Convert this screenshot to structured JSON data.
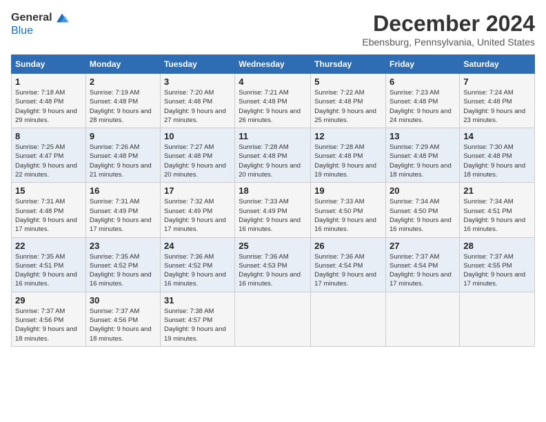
{
  "header": {
    "logo_general": "General",
    "logo_blue": "Blue",
    "month_title": "December 2024",
    "location": "Ebensburg, Pennsylvania, United States"
  },
  "days_of_week": [
    "Sunday",
    "Monday",
    "Tuesday",
    "Wednesday",
    "Thursday",
    "Friday",
    "Saturday"
  ],
  "weeks": [
    [
      {
        "day": "1",
        "sunrise": "7:18 AM",
        "sunset": "4:48 PM",
        "daylight": "9 hours and 29 minutes."
      },
      {
        "day": "2",
        "sunrise": "7:19 AM",
        "sunset": "4:48 PM",
        "daylight": "9 hours and 28 minutes."
      },
      {
        "day": "3",
        "sunrise": "7:20 AM",
        "sunset": "4:48 PM",
        "daylight": "9 hours and 27 minutes."
      },
      {
        "day": "4",
        "sunrise": "7:21 AM",
        "sunset": "4:48 PM",
        "daylight": "9 hours and 26 minutes."
      },
      {
        "day": "5",
        "sunrise": "7:22 AM",
        "sunset": "4:48 PM",
        "daylight": "9 hours and 25 minutes."
      },
      {
        "day": "6",
        "sunrise": "7:23 AM",
        "sunset": "4:48 PM",
        "daylight": "9 hours and 24 minutes."
      },
      {
        "day": "7",
        "sunrise": "7:24 AM",
        "sunset": "4:48 PM",
        "daylight": "9 hours and 23 minutes."
      }
    ],
    [
      {
        "day": "8",
        "sunrise": "7:25 AM",
        "sunset": "4:47 PM",
        "daylight": "9 hours and 22 minutes."
      },
      {
        "day": "9",
        "sunrise": "7:26 AM",
        "sunset": "4:48 PM",
        "daylight": "9 hours and 21 minutes."
      },
      {
        "day": "10",
        "sunrise": "7:27 AM",
        "sunset": "4:48 PM",
        "daylight": "9 hours and 20 minutes."
      },
      {
        "day": "11",
        "sunrise": "7:28 AM",
        "sunset": "4:48 PM",
        "daylight": "9 hours and 20 minutes."
      },
      {
        "day": "12",
        "sunrise": "7:28 AM",
        "sunset": "4:48 PM",
        "daylight": "9 hours and 19 minutes."
      },
      {
        "day": "13",
        "sunrise": "7:29 AM",
        "sunset": "4:48 PM",
        "daylight": "9 hours and 18 minutes."
      },
      {
        "day": "14",
        "sunrise": "7:30 AM",
        "sunset": "4:48 PM",
        "daylight": "9 hours and 18 minutes."
      }
    ],
    [
      {
        "day": "15",
        "sunrise": "7:31 AM",
        "sunset": "4:48 PM",
        "daylight": "9 hours and 17 minutes."
      },
      {
        "day": "16",
        "sunrise": "7:31 AM",
        "sunset": "4:49 PM",
        "daylight": "9 hours and 17 minutes."
      },
      {
        "day": "17",
        "sunrise": "7:32 AM",
        "sunset": "4:49 PM",
        "daylight": "9 hours and 17 minutes."
      },
      {
        "day": "18",
        "sunrise": "7:33 AM",
        "sunset": "4:49 PM",
        "daylight": "9 hours and 16 minutes."
      },
      {
        "day": "19",
        "sunrise": "7:33 AM",
        "sunset": "4:50 PM",
        "daylight": "9 hours and 16 minutes."
      },
      {
        "day": "20",
        "sunrise": "7:34 AM",
        "sunset": "4:50 PM",
        "daylight": "9 hours and 16 minutes."
      },
      {
        "day": "21",
        "sunrise": "7:34 AM",
        "sunset": "4:51 PM",
        "daylight": "9 hours and 16 minutes."
      }
    ],
    [
      {
        "day": "22",
        "sunrise": "7:35 AM",
        "sunset": "4:51 PM",
        "daylight": "9 hours and 16 minutes."
      },
      {
        "day": "23",
        "sunrise": "7:35 AM",
        "sunset": "4:52 PM",
        "daylight": "9 hours and 16 minutes."
      },
      {
        "day": "24",
        "sunrise": "7:36 AM",
        "sunset": "4:52 PM",
        "daylight": "9 hours and 16 minutes."
      },
      {
        "day": "25",
        "sunrise": "7:36 AM",
        "sunset": "4:53 PM",
        "daylight": "9 hours and 16 minutes."
      },
      {
        "day": "26",
        "sunrise": "7:36 AM",
        "sunset": "4:54 PM",
        "daylight": "9 hours and 17 minutes."
      },
      {
        "day": "27",
        "sunrise": "7:37 AM",
        "sunset": "4:54 PM",
        "daylight": "9 hours and 17 minutes."
      },
      {
        "day": "28",
        "sunrise": "7:37 AM",
        "sunset": "4:55 PM",
        "daylight": "9 hours and 17 minutes."
      }
    ],
    [
      {
        "day": "29",
        "sunrise": "7:37 AM",
        "sunset": "4:56 PM",
        "daylight": "9 hours and 18 minutes."
      },
      {
        "day": "30",
        "sunrise": "7:37 AM",
        "sunset": "4:56 PM",
        "daylight": "9 hours and 18 minutes."
      },
      {
        "day": "31",
        "sunrise": "7:38 AM",
        "sunset": "4:57 PM",
        "daylight": "9 hours and 19 minutes."
      },
      null,
      null,
      null,
      null
    ]
  ]
}
